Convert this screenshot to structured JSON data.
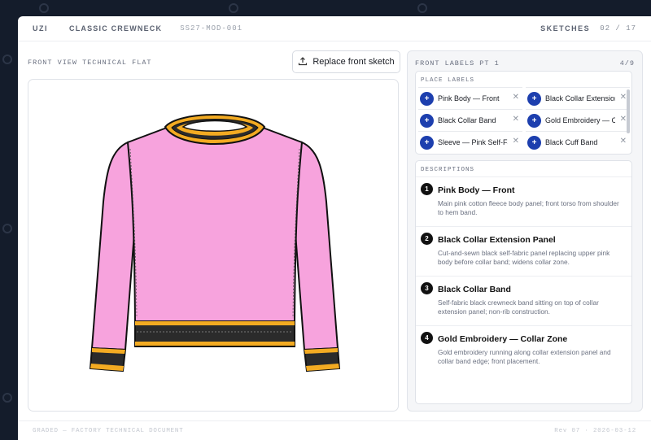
{
  "header": {
    "app": "UZI",
    "title": "CLASSIC CREWNECK",
    "code": "SS27-MOD-001",
    "section_label": "SKETCHES",
    "counter": "02 / 17"
  },
  "left_panel": {
    "label": "FRONT VIEW TECHNICAL FLAT",
    "replace_button": "Replace front sketch",
    "upload_icon": "upload-icon"
  },
  "right_panel": {
    "title": "FRONT LABELS PT 1",
    "page": "4/9",
    "place_labels_heading": "PLACE LABELS",
    "chips": [
      {
        "label": "Pink Body — Front"
      },
      {
        "label": "Black Collar Extension Panel"
      },
      {
        "label": "Black Collar Band"
      },
      {
        "label": "Gold Embroidery — Collar Zone"
      },
      {
        "label": "Sleeve — Pink Self-Fabric"
      },
      {
        "label": "Black Cuff Band"
      }
    ],
    "descriptions_heading": "DESCRIPTIONS",
    "descriptions": [
      {
        "num": "1",
        "title": "Pink Body — Front",
        "text": "Main pink cotton fleece body panel; front torso from shoulder to hem band."
      },
      {
        "num": "2",
        "title": "Black Collar Extension Panel",
        "text": "Cut-and-sewn black self-fabric panel replacing upper pink body before collar band; widens collar zone."
      },
      {
        "num": "3",
        "title": "Black Collar Band",
        "text": "Self-fabric black crewneck band sitting on top of collar extension panel; non-rib construction."
      },
      {
        "num": "4",
        "title": "Gold Embroidery — Collar Zone",
        "text": "Gold embroidery running along collar extension panel and collar band edge; front placement."
      }
    ]
  },
  "footer": {
    "left": "GRADED — FACTORY TECHNICAL DOCUMENT",
    "right": "Rev 07 · 2026-03-12"
  },
  "colors": {
    "background": "#141c2b",
    "body_pink": "#f7a3dd",
    "collar_gold": "#f3ab22",
    "band_black": "#2b2b2b",
    "chip_blue": "#1d3fae"
  }
}
